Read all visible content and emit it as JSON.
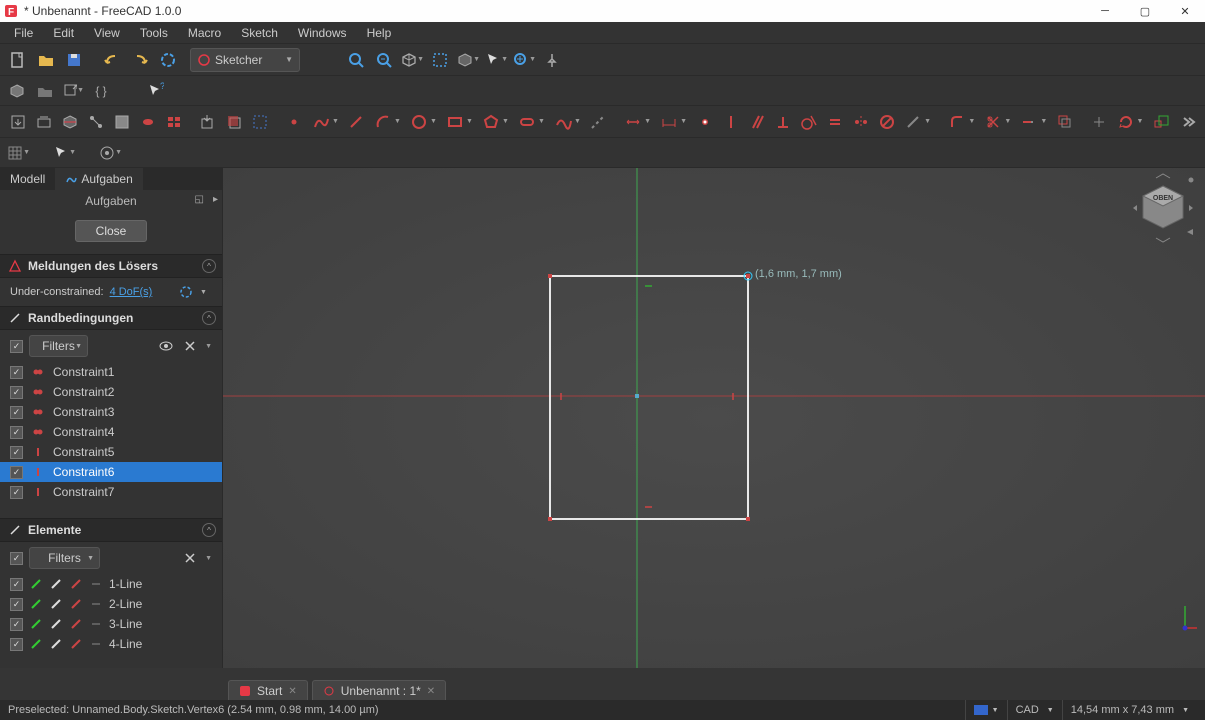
{
  "window": {
    "title": "* Unbenannt - FreeCAD 1.0.0"
  },
  "menu": {
    "items": [
      "File",
      "Edit",
      "View",
      "Tools",
      "Macro",
      "Sketch",
      "Windows",
      "Help"
    ]
  },
  "workbench": {
    "selected": "Sketcher"
  },
  "tabs": {
    "modell": "Modell",
    "aufgaben": "Aufgaben"
  },
  "tasks": {
    "header": "Aufgaben",
    "close": "Close"
  },
  "solver": {
    "title": "Meldungen des Lösers",
    "status_label": "Under-constrained:",
    "dof": "4 DoF(s)"
  },
  "constraints_panel": {
    "title": "Randbedingungen",
    "filter_label": "Filters",
    "items": [
      {
        "label": "Constraint1",
        "type": "coincident"
      },
      {
        "label": "Constraint2",
        "type": "coincident"
      },
      {
        "label": "Constraint3",
        "type": "coincident"
      },
      {
        "label": "Constraint4",
        "type": "coincident"
      },
      {
        "label": "Constraint5",
        "type": "vertical"
      },
      {
        "label": "Constraint6",
        "type": "vertical",
        "selected": true
      },
      {
        "label": "Constraint7",
        "type": "vertical"
      }
    ]
  },
  "elements_panel": {
    "title": "Elemente",
    "filter_label": "Filters",
    "items": [
      {
        "label": "1-Line"
      },
      {
        "label": "2-Line"
      },
      {
        "label": "3-Line"
      },
      {
        "label": "4-Line"
      }
    ]
  },
  "canvas": {
    "cursor_coord": "(1,6 mm, 1,7 mm)",
    "cube_face": "OBEN"
  },
  "doc_tabs": {
    "start": "Start",
    "doc": "Unbenannt : 1*"
  },
  "status": {
    "preselect": "Preselected: Unnamed.Body.Sketch.Vertex6 (2.54 mm, 0.98 mm, 14.00 µm)",
    "mode": "CAD",
    "dims": "14,54 mm x 7,43 mm"
  }
}
